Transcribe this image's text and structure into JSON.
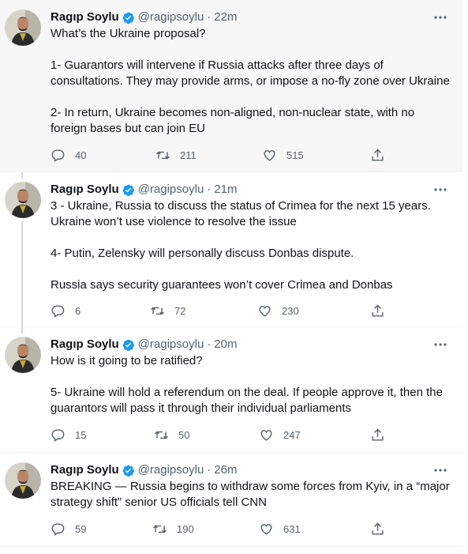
{
  "tweets": [
    {
      "name": "Ragıp Soylu",
      "handle": "@ragipsoylu",
      "dot": "·",
      "time": "22m",
      "lines": [
        "What’s the Ukraine proposal?",
        "",
        "1- Guarantors will intervene if Russia attacks after three days of",
        "consultations. They may provide arms, or impose a no-fly zone over Ukraine",
        "",
        "2- In return, Ukraine becomes non-aligned, non-nuclear state, with no",
        "foreign bases but can join EU"
      ],
      "replies": "40",
      "retweets": "211",
      "likes": "515"
    },
    {
      "name": "Ragıp Soylu",
      "handle": "@ragipsoylu",
      "dot": "·",
      "time": "21m",
      "lines": [
        "3 - Ukraine, Russia to discuss the status of Crimea for the next 15 years.",
        "Ukraine won’t use violence to resolve the issue",
        "",
        "4- Putin, Zelensky will personally discuss Donbas dispute.",
        "",
        "Russia says security guarantees won’t cover Crimea and Donbas"
      ],
      "replies": "6",
      "retweets": "72",
      "likes": "230"
    },
    {
      "name": "Ragıp Soylu",
      "handle": "@ragipsoylu",
      "dot": "·",
      "time": "20m",
      "lines": [
        "How is it going to be ratified?",
        "",
        "5- Ukraine will hold a referendum on the deal. If people approve it, then the",
        "guarantors will pass it through their individual parliaments"
      ],
      "replies": "15",
      "retweets": "50",
      "likes": "247"
    },
    {
      "name": "Ragıp Soylu",
      "handle": "@ragipsoylu",
      "dot": "·",
      "time": "26m",
      "lines": [
        "BREAKING — Russia begins to withdraw some forces from Kyiv, in a “major",
        "strategy shift” senior US officials tell CNN"
      ],
      "replies": "59",
      "retweets": "190",
      "likes": "631"
    }
  ],
  "colors": {
    "verified": "#1d9bf0",
    "muted": "#536471",
    "highlight_bg": "#f7f7f7",
    "thread_line": "#cfd9de"
  },
  "icons": {
    "verified": "verified-badge-icon",
    "more": "more-dots-icon",
    "reply": "reply-bubble-icon",
    "retweet": "retweet-icon",
    "like": "heart-icon",
    "share": "share-icon"
  }
}
